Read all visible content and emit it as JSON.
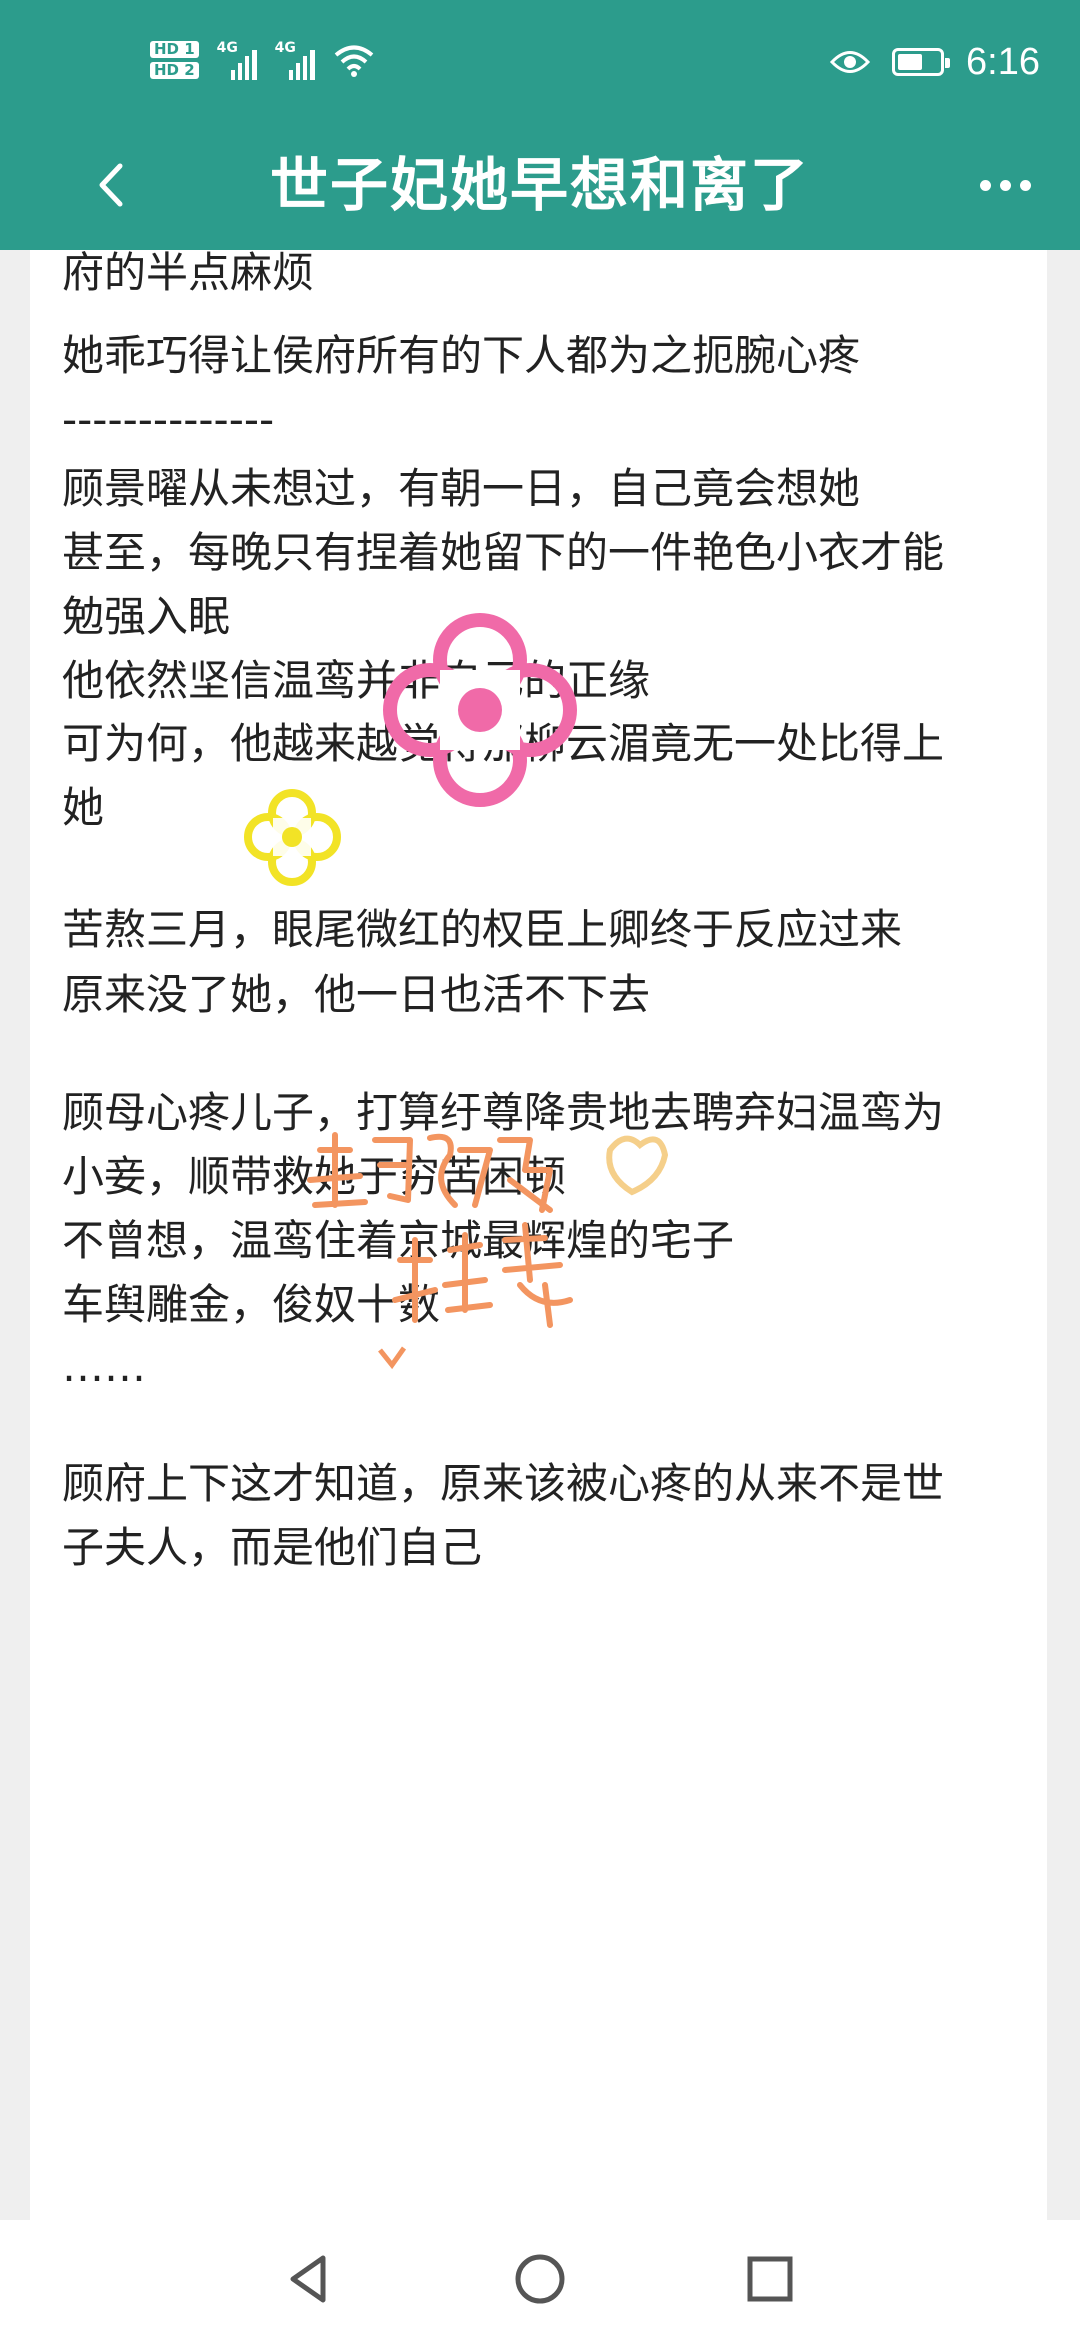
{
  "status_bar": {
    "sim1": "HD 1",
    "sim2": "HD 2",
    "network1": "4G",
    "network2": "4G",
    "time": "6:16",
    "battery_level": 0.6,
    "icons": [
      "signal-icon",
      "wifi-icon",
      "eye-icon",
      "battery-icon"
    ]
  },
  "header": {
    "title": "世子妃她早想和离了",
    "back_icon": "chevron-left-icon",
    "more_icon": "more-dots-icon"
  },
  "content": {
    "lines": [
      "府的半点麻烦",
      "她乖巧得让侯府所有的下人都为之扼腕心疼",
      "--------------",
      "顾景曜从未想过，有朝一日，自己竟会想她",
      "甚至，每晚只有捏着她留下的一件艳色小衣才能",
      "勉强入眠",
      "他依然坚信温鸾并非自己的正缘",
      "可为何，他越来越觉得那柳云湄竟无一处比得上",
      "她",
      "苦熬三月，眼尾微红的权臣上卿终于反应过来",
      "原来没了她，他一日也活不下去",
      "顾母心疼儿子，打算纡尊降贵地去聘弃妇温鸾为",
      "小妾，顺带救她于穷苦困顿",
      "不曾想，温鸾住着京城最辉煌的宅子",
      "车舆雕金，俊奴十数",
      "……",
      "顾府上下这才知道，原来该被心疼的从来不是世",
      "子夫人，而是他们自己"
    ],
    "handwritten_sticker": "超级推荐"
  },
  "nav_bar": {
    "icons": [
      "back-triangle-icon",
      "home-circle-icon",
      "recents-square-icon"
    ]
  }
}
